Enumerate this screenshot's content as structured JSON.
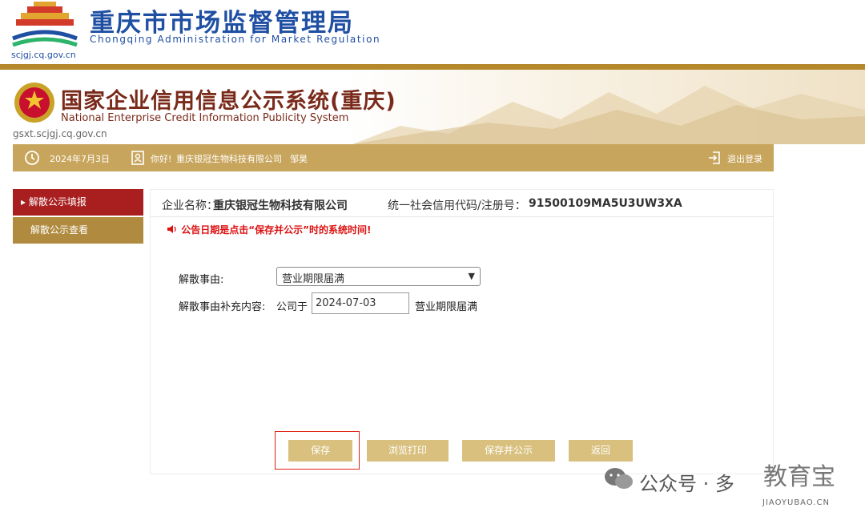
{
  "agency": {
    "name_cn": "重庆市市场监督管理局",
    "name_en": "Chongqing Administration for Market Regulation",
    "domain": "scjgj.cq.gov.cn"
  },
  "system": {
    "title": "国家企业信用信息公示系统(重庆)",
    "subtitle": "National Enterprise Credit Information Publicity System",
    "domain": "gsxt.scjgj.cq.gov.cn"
  },
  "infobar": {
    "date": "2024年7月3日",
    "greeting": "你好!",
    "company": "重庆银冠生物科技有限公司",
    "user": "邹昊",
    "logout": "退出登录"
  },
  "sidebar": {
    "items": [
      {
        "label": "▸ 解散公示填报",
        "active": true
      },
      {
        "label": "解散公示查看",
        "active": false
      }
    ]
  },
  "form": {
    "company_label": "企业名称：",
    "company_name": "重庆银冠生物科技有限公司",
    "credit_code_label": "统一社会信用代码/注册号：",
    "credit_code": "91500109MA5U3UW3XA",
    "notice": "公告日期是点击“保存并公示”时的系统时间!",
    "reason_label": "解散事由:",
    "reason_value": "营业期限届满",
    "supplement_label": "解散事由补充内容:",
    "supplement_prefix": "公司于",
    "supplement_date": "2024-07-03",
    "supplement_suffix": "营业期限届满"
  },
  "buttons": {
    "save": "保存",
    "preview_print": "浏览打印",
    "save_publish": "保存并公示",
    "back": "返回"
  },
  "watermark": {
    "text": "公众号 · 多",
    "site": "JIAOYUBAO.CN",
    "logo": "教育宝"
  },
  "colors": {
    "brand_blue": "#1f4fa3",
    "gold": "#c8a55c",
    "red_active": "#a91f1f",
    "button": "#d9c07e"
  }
}
